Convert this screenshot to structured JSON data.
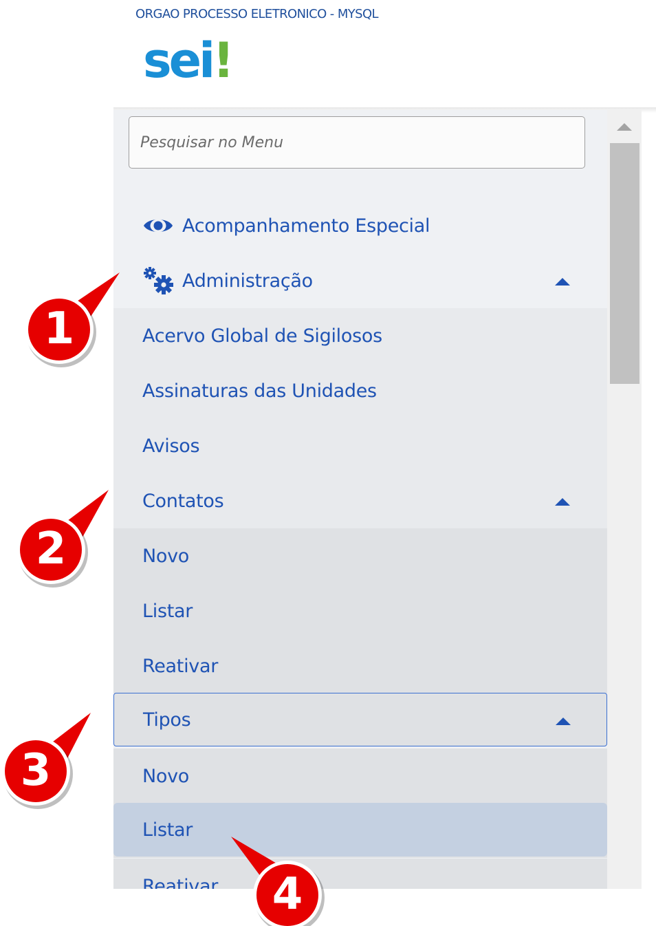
{
  "header": {
    "org_title": "ORGAO PROCESSO ELETRONICO - MYSQL",
    "logo_text_main": "sei",
    "logo_text_bang": "!"
  },
  "search": {
    "placeholder": "Pesquisar no Menu"
  },
  "menu": {
    "acompanhamento": {
      "label": "Acompanhamento Especial",
      "icon": "eye-icon"
    },
    "administracao": {
      "label": "Administração",
      "icon": "gears-icon",
      "expanded": true
    },
    "admin_items": {
      "acervo": "Acervo Global de Sigilosos",
      "assinaturas": "Assinaturas das Unidades",
      "avisos": "Avisos",
      "contatos": "Contatos"
    },
    "contatos_items": {
      "novo": "Novo",
      "listar": "Listar",
      "reativar": "Reativar",
      "tipos": "Tipos"
    },
    "tipos_items": {
      "novo": "Novo",
      "listar": "Listar",
      "reativar": "Reativar"
    }
  },
  "callouts": [
    "1",
    "2",
    "3",
    "4"
  ],
  "colors": {
    "link": "#1f53b4",
    "callout_red": "#e60000",
    "selected_row": "#c4d0e1",
    "logo_blue": "#1a8fd6",
    "logo_green": "#6ab43e"
  }
}
